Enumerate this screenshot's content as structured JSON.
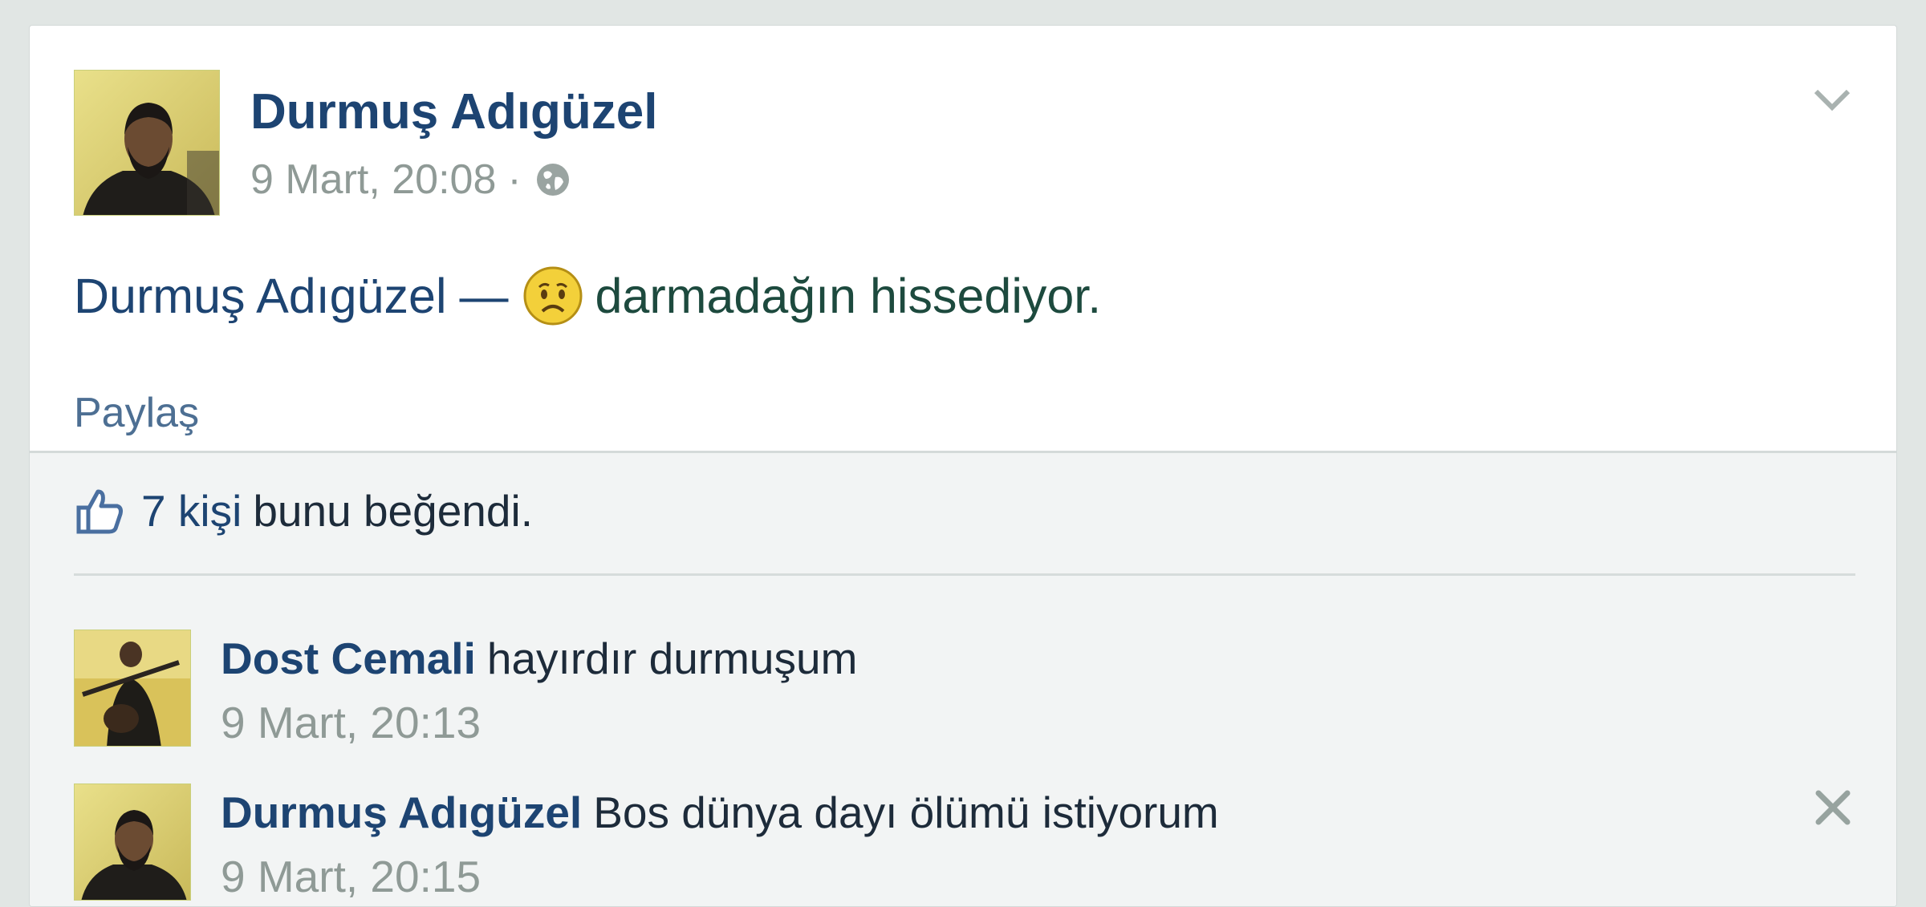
{
  "post": {
    "author": "Durmuş Adıgüzel",
    "timestamp": "9 Mart, 20:08",
    "separator": "·",
    "privacy_icon": "globe-icon",
    "status_author": "Durmuş Adıgüzel",
    "status_dash": "—",
    "feeling_icon": "sad-face-emoji",
    "feeling_text": "darmadağın hissediyor.",
    "share_label": "Paylaş"
  },
  "likes": {
    "icon": "thumbs-up-icon",
    "count_text": "7 kişi",
    "suffix": "bunu beğendi."
  },
  "comments": [
    {
      "author": "Dost Cemali",
      "text": "hayırdır durmuşum",
      "timestamp": "9 Mart, 20:13"
    },
    {
      "author": "Durmuş Adıgüzel",
      "text": "Bos dünya dayı ölümü istiyorum",
      "timestamp": "9 Mart, 20:15",
      "action_icon": "close-icon"
    }
  ],
  "colors": {
    "name_blue": "#1d4472",
    "meta_gray": "#8f9a96",
    "page_bg": "#e1e6e4",
    "footer_bg": "#f2f4f4"
  }
}
